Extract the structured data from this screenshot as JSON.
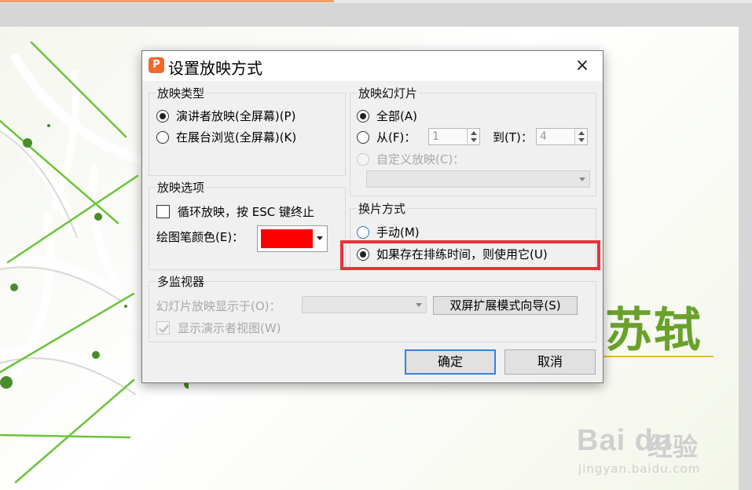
{
  "dialog": {
    "app_icon": "P",
    "title": "设置放映方式",
    "close_icon": "×",
    "show_type": {
      "legend": "放映类型",
      "options": [
        {
          "label": "演讲者放映(全屏幕)(P)",
          "selected": true
        },
        {
          "label": "在展台浏览(全屏幕)(K)",
          "selected": false
        }
      ]
    },
    "show_slides": {
      "legend": "放映幻灯片",
      "all_label": "全部(A)",
      "from_label": "从(F)：",
      "from_value": "1",
      "to_label": "到(T)：",
      "to_value": "4",
      "custom_label": "自定义放映(C)："
    },
    "show_options": {
      "legend": "放映选项",
      "loop_label": "循环放映，按 ESC 键终止",
      "pen_color_label": "绘图笔颜色(E)：",
      "pen_color": "#ff0000"
    },
    "advance": {
      "legend": "换片方式",
      "manual_label": "手动(M)",
      "timing_label": "如果存在排练时间，则使用它(U)"
    },
    "monitors": {
      "legend": "多监视器",
      "display_on_label": "幻灯片放映显示于(O)：",
      "wizard_button": "双屏扩展模式向导(S)",
      "presenter_view_label": "显示演示者视图(W)"
    },
    "ok_button": "确定",
    "cancel_button": "取消"
  },
  "slide": {
    "title": "苏轼",
    "accent_color": "#6aa12b"
  },
  "watermark": {
    "logo": "Bai du",
    "brand": "经验",
    "url": "jingyan.baidu.com"
  }
}
